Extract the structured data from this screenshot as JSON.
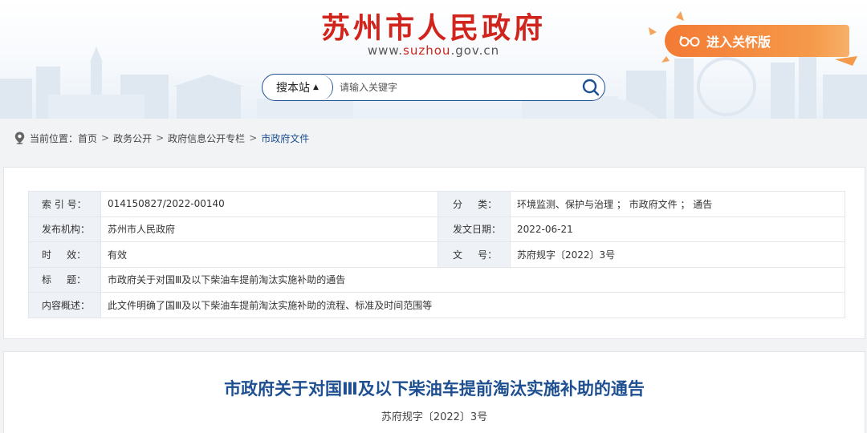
{
  "header": {
    "site_title": "苏州市人民政府",
    "url_prefix": "www.",
    "url_highlight": "suzhou",
    "url_suffix": ".gov.cn",
    "care_mode_label": "进入关怀版",
    "care_mode_icon": "glasses-icon"
  },
  "search": {
    "scope_label": "搜本站",
    "placeholder": "请输入关键字",
    "button_icon": "search-icon"
  },
  "breadcrumb": {
    "prefix": "当前位置：",
    "items": [
      "首页",
      "政务公开",
      "政府信息公开专栏",
      "市政府文件"
    ],
    "separator": ">"
  },
  "info": {
    "index_label": "索 引 号：",
    "index_value": "014150827/2022-00140",
    "category_label": "分     类：",
    "category_value": "环境监测、保护与治理 ； 市政府文件 ； 通告",
    "publisher_label": "发布机构：",
    "publisher_value": "苏州市人民政府",
    "date_label": "发文日期：",
    "date_value": "2022-06-21",
    "validity_label": "时     效：",
    "validity_value": "有效",
    "docno_label": "文     号：",
    "docno_value": "苏府规字〔2022〕3号",
    "title_label": "标     题：",
    "title_value": "市政府关于对国Ⅲ及以下柴油车提前淘汰实施补助的通告",
    "summary_label": "内容概述：",
    "summary_value": "此文件明确了国Ⅲ及以下柴油车提前淘汰实施补助的流程、标准及时间范围等"
  },
  "article": {
    "title": "市政府关于对国Ⅲ及以下柴油车提前淘汰实施补助的通告",
    "doc_number": "苏府规字〔2022〕3号"
  },
  "colors": {
    "brand_red": "#d1241c",
    "brand_blue": "#1d4f91",
    "care_orange": "#f47a34"
  }
}
